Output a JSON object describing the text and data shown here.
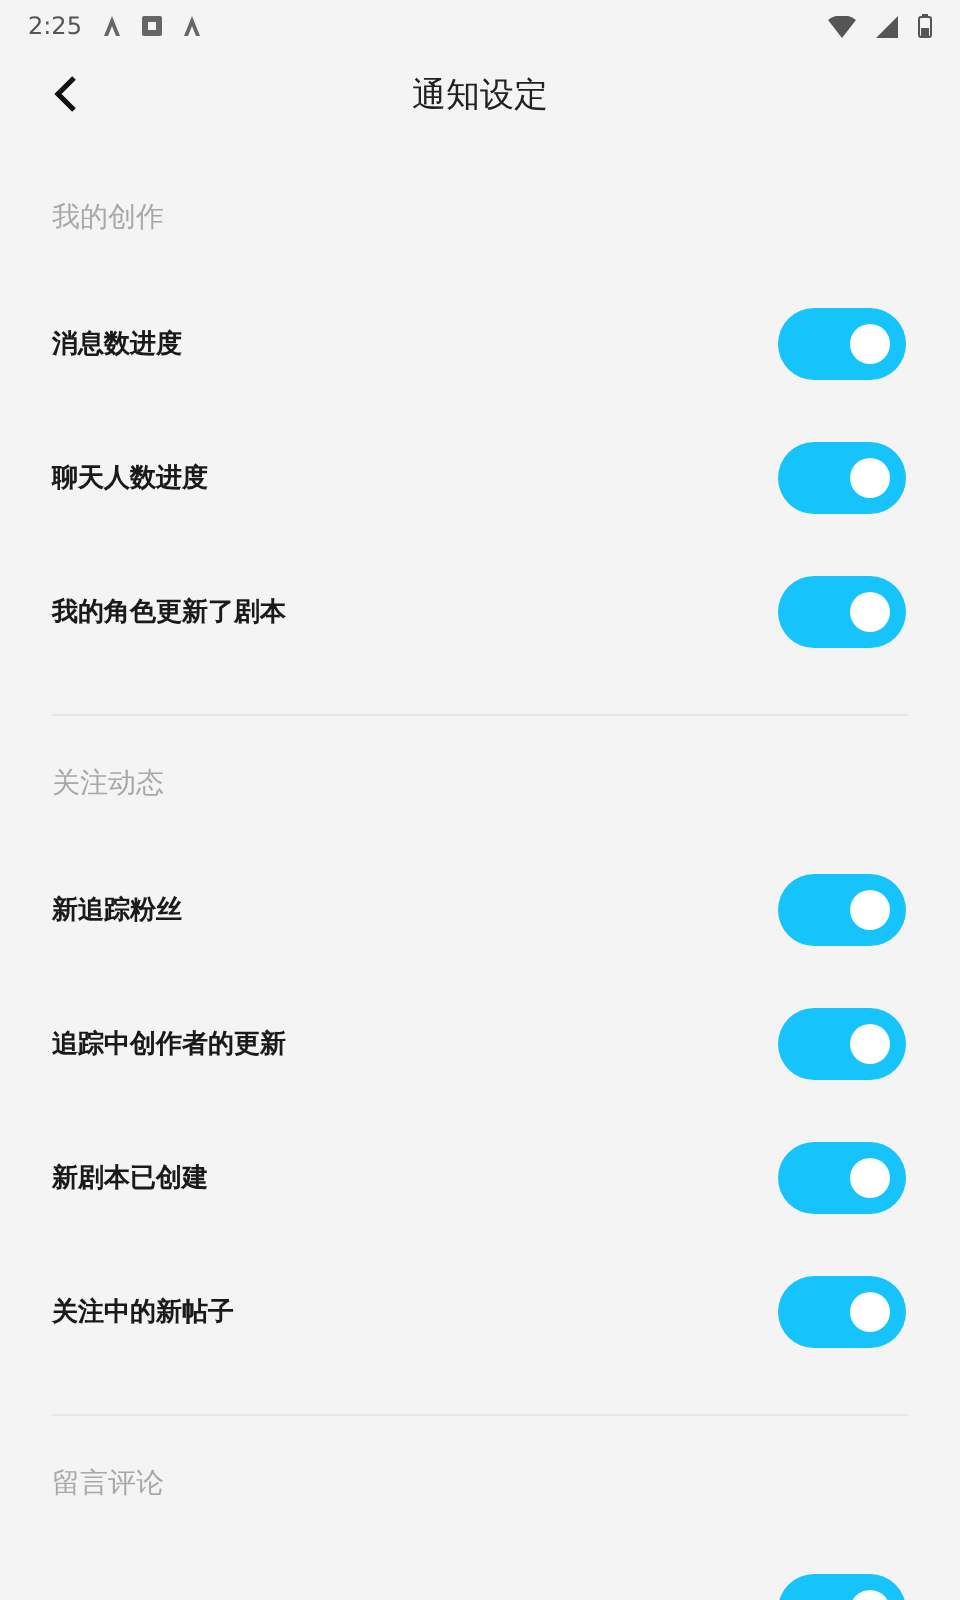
{
  "status_bar": {
    "time": "2:25"
  },
  "header": {
    "title": "通知设定"
  },
  "sections": [
    {
      "title": "我的创作",
      "items": [
        {
          "label": "消息数进度",
          "on": true
        },
        {
          "label": "聊天人数进度",
          "on": true
        },
        {
          "label": "我的角色更新了剧本",
          "on": true
        }
      ]
    },
    {
      "title": "关注动态",
      "items": [
        {
          "label": "新追踪粉丝",
          "on": true
        },
        {
          "label": "追踪中创作者的更新",
          "on": true
        },
        {
          "label": "新剧本已创建",
          "on": true
        },
        {
          "label": "关注中的新帖子",
          "on": true
        }
      ]
    },
    {
      "title": "留言评论",
      "items": [
        {
          "on": true
        }
      ]
    }
  ]
}
